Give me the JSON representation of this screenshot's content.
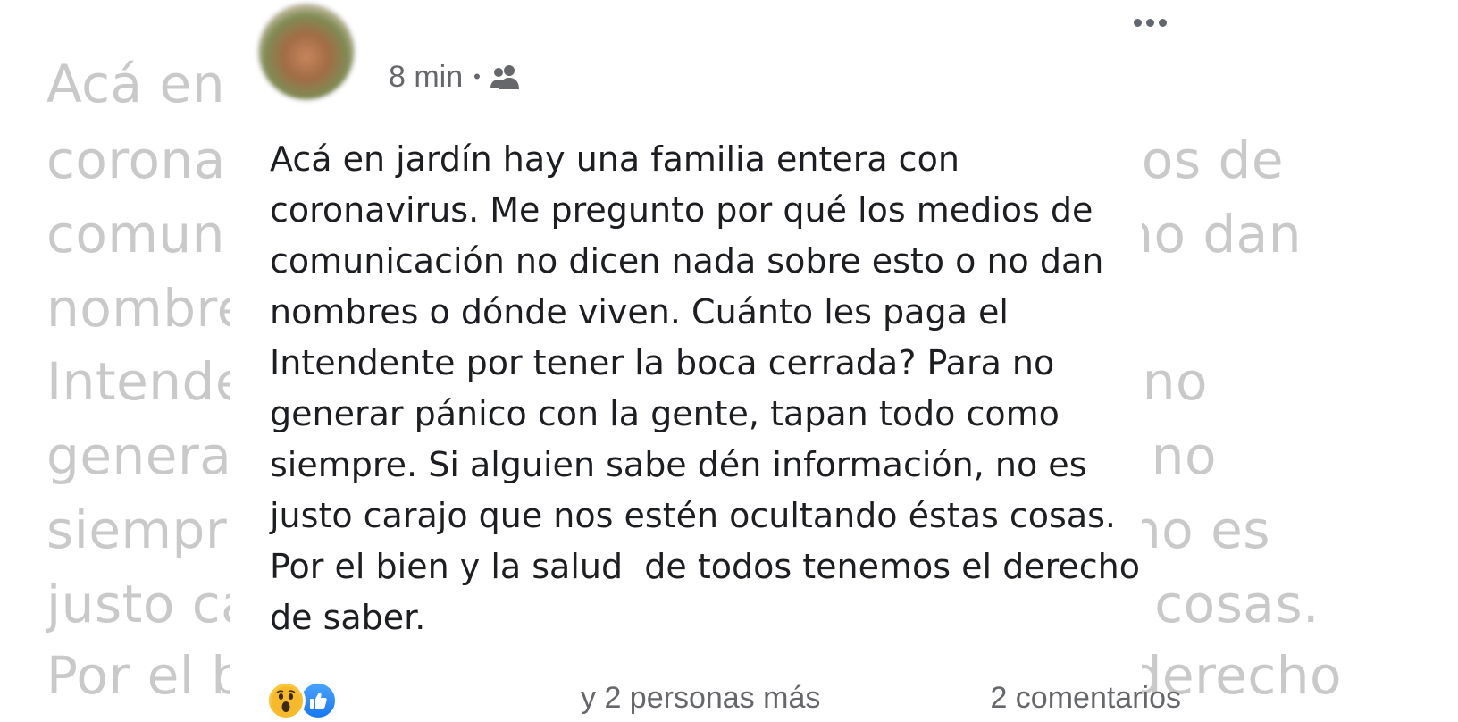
{
  "background_text": {
    "left_lines": [
      "Acá en",
      "corona",
      "comuni",
      "nombre",
      "Intende",
      "general",
      "siempr",
      "justo ca",
      "Por el b"
    ],
    "right_lines": [
      "os de",
      "no dan",
      "no",
      "no",
      "no es",
      "cosas.",
      "derecho"
    ]
  },
  "post": {
    "timestamp": "8 min",
    "separator": "•",
    "audience_icon": "group-icon",
    "more_icon": "more-options-icon",
    "text": "Acá en jardín hay una familia entera con\ncoronavirus. Me pregunto por qué los medios de\ncomunicación no dicen nada sobre esto o no dan\nnombres o dónde viven. Cuánto les paga el\nIntendente por tener la boca cerrada? Para no\ngenerar pánico con la gente, tapan todo como\nsiempre. Si alguien sabe dén información, no es\njusto carajo que nos estén ocultando éstas cosas.\nPor el bien y la salud  de todos tenemos el derecho\nde saber."
  },
  "footer": {
    "reactions": [
      "wow-reaction-icon",
      "like-reaction-icon"
    ],
    "others_text": "y 2 personas más",
    "comments_text": "2 comentarios"
  },
  "colors": {
    "text": "#1c1e21",
    "meta": "#65676b",
    "faded": "#c9c9c9",
    "like_blue": "#1877f2",
    "wow_yellow": "#f7b928"
  }
}
